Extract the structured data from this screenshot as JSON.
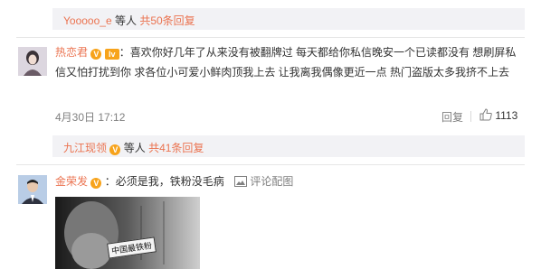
{
  "reply_bar_1": {
    "user": "Yooooo_e",
    "text": "等人",
    "count": "共50条回复"
  },
  "comment_1": {
    "username": "热恋君",
    "badge": "lv",
    "text": "：喜欢你好几年了从来没有被翻牌过   每天都给你私信晚安一个已读都没有  想刷屏私信又怕打扰到你  求各位小可爱小鲜肉顶我上去 让我离我偶像更近一点  热门盗版太多我挤不上去",
    "date": "4月30日 17:12",
    "reply_label": "回复",
    "like_count": "1113"
  },
  "reply_bar_2": {
    "user": "九江现领",
    "text": "等人",
    "count": "共41条回复"
  },
  "comment_2": {
    "username": "金荣发",
    "text": "：必须是我，铁粉没毛病",
    "pic_label": "评论配图",
    "image_caption": "中国最铁粉"
  },
  "colors": {
    "link": "#eb7350",
    "reply_bg": "#f2f2f5",
    "gray": "#808080"
  },
  "icons": {
    "verified": "v-badge-icon",
    "like": "thumbs-up-icon",
    "picture": "picture-icon"
  }
}
